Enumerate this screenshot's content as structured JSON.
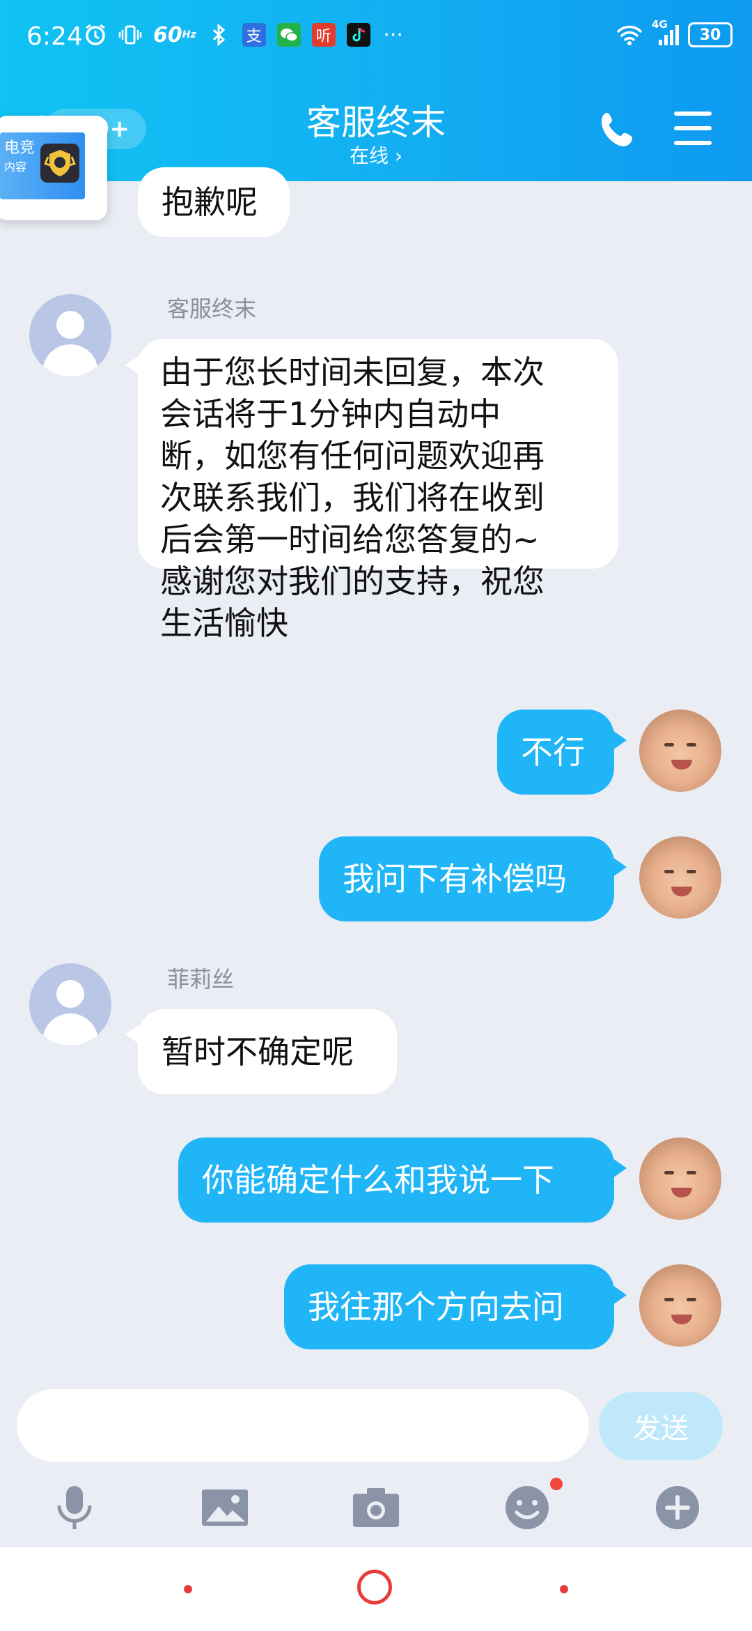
{
  "status_bar": {
    "time": "6:24",
    "refresh_rate": "60",
    "refresh_unit": "Hz",
    "network": "4G",
    "battery": "30",
    "more": "···",
    "app_labels": [
      "支",
      "听"
    ]
  },
  "header": {
    "back_badge": "99+",
    "title": "客服终末",
    "status": "在线 ›"
  },
  "floating_widget": {
    "line1": "电竞",
    "line2": "内容"
  },
  "messages": [
    {
      "from": "in",
      "sender": "",
      "text": "抱歉呢"
    },
    {
      "from": "in",
      "sender": "客服终末",
      "lines": [
        "由于您长时间未回复，本次",
        "会话将于1分钟内自动中",
        "断，如您有任何问题欢迎再",
        "次联系我们，我们将在收到",
        "后会第一时间给您答复的~",
        "感谢您对我们的支持，祝您",
        "生活愉快"
      ]
    },
    {
      "from": "out",
      "text": "不行"
    },
    {
      "from": "out",
      "text": "我问下有补偿吗"
    },
    {
      "from": "in",
      "sender": "菲莉丝",
      "text": "暂时不确定呢"
    },
    {
      "from": "out",
      "text": "你能确定什么和我说一下"
    },
    {
      "from": "out",
      "text": "我往那个方向去问"
    }
  ],
  "input": {
    "placeholder": "",
    "send_label": "发送"
  },
  "toolbar": {
    "icons": [
      "microphone-icon",
      "image-icon",
      "camera-icon",
      "emoji-icon",
      "plus-icon"
    ],
    "emoji_has_notification": true
  },
  "colors": {
    "header_gradient": [
      "#10c3f3",
      "#0d9af0"
    ],
    "outgoing_bubble": "#1fb5f7",
    "incoming_bubble": "#ffffff",
    "background": "#eaedf4",
    "send_button_disabled": "#bfe9fb"
  }
}
